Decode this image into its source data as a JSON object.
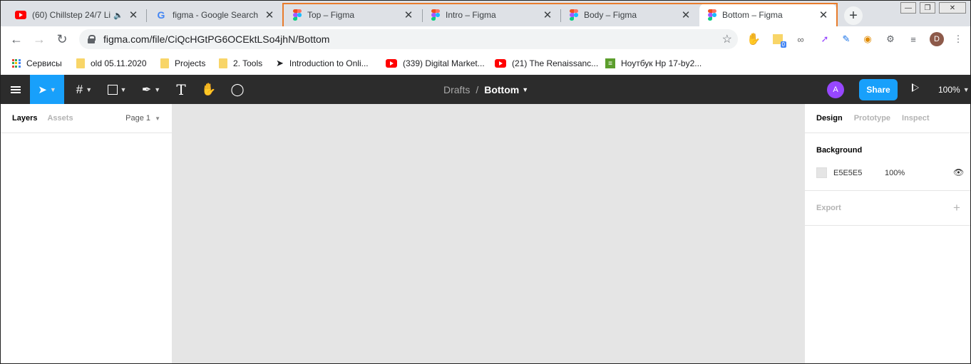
{
  "browser": {
    "tabs": [
      {
        "title": "(60) Chillstep 24/7 Li",
        "icon": "youtube-icon"
      },
      {
        "title": "figma - Google Search",
        "icon": "google-icon"
      },
      {
        "title": "Top – Figma",
        "icon": "figma-icon"
      },
      {
        "title": "Intro – Figma",
        "icon": "figma-icon"
      },
      {
        "title": "Body – Figma",
        "icon": "figma-icon"
      },
      {
        "title": "Bottom – Figma",
        "icon": "figma-icon",
        "active": true
      }
    ],
    "url": "figma.com/file/CiQcHGtPG6OCEktLSo4jhN/Bottom",
    "extension_badge": "0",
    "profile_initial": "D",
    "bookmarks": [
      {
        "label": "Сервисы",
        "icon": "apps-icon"
      },
      {
        "label": "old 05.11.2020",
        "icon": "folder-icon"
      },
      {
        "label": "Projects",
        "icon": "folder-icon"
      },
      {
        "label": "2. Tools",
        "icon": "folder-icon"
      },
      {
        "label": "Introduction to Onli...",
        "icon": "pin-icon"
      },
      {
        "label": "(339) Digital Market...",
        "icon": "youtube-icon"
      },
      {
        "label": "(21) The Renaissanc...",
        "icon": "youtube-icon"
      },
      {
        "label": "Ноутбук Hp 17-by2...",
        "icon": "shop-icon"
      }
    ],
    "highlight_color": "#e87c2c"
  },
  "figma": {
    "breadcrumb": {
      "project": "Drafts",
      "separator": "/",
      "file": "Bottom"
    },
    "user_initial": "A",
    "share_label": "Share",
    "zoom": "100%",
    "accent": "#18a0fb",
    "left_panel": {
      "tab_layers": "Layers",
      "tab_assets": "Assets",
      "page": "Page 1"
    },
    "right_panel": {
      "tab_design": "Design",
      "tab_prototype": "Prototype",
      "tab_inspect": "Inspect",
      "background_title": "Background",
      "background_hex": "E5E5E5",
      "background_opacity": "100%",
      "export_title": "Export"
    },
    "canvas_color": "#E5E5E5"
  }
}
